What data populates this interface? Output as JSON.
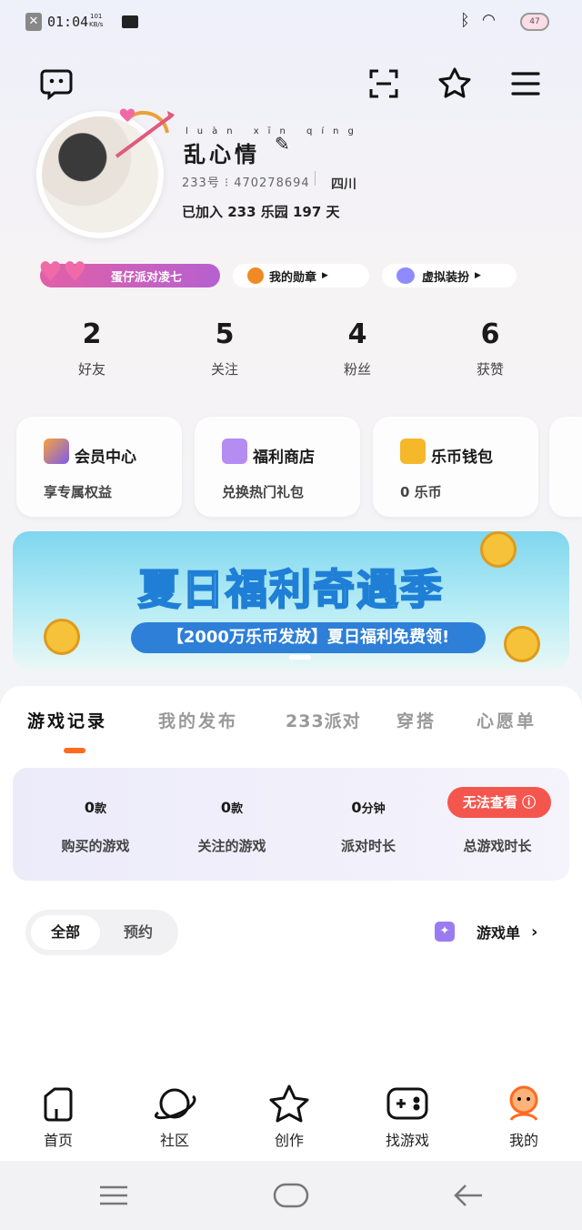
{
  "status": {
    "time": "01:04",
    "speed_top": "101",
    "speed_bottom": "KB/s",
    "battery": "47"
  },
  "profile": {
    "name": "乱心情",
    "name_pinyin": "luàn xīn qíng",
    "uid": "233号 ⁝ 470278694",
    "location": "四川",
    "joined": "已加入 233 乐园 197 天"
  },
  "chips": {
    "party": "蛋仔派对凌七",
    "medal": "我的勋章",
    "dress": "虚拟装扮"
  },
  "stats": [
    {
      "value": "2",
      "label": "好友"
    },
    {
      "value": "5",
      "label": "关注"
    },
    {
      "value": "4",
      "label": "粉丝"
    },
    {
      "value": "6",
      "label": "获赞"
    }
  ],
  "cards": [
    {
      "title": "会员中心",
      "sub": "享专属权益",
      "color": "#7b5cf0"
    },
    {
      "title": "福利商店",
      "sub": "兑换热门礼包",
      "color": "#b48cf2"
    },
    {
      "title": "乐币钱包",
      "sub": "0 乐币",
      "color": "#f5b82a"
    }
  ],
  "banner": {
    "title": "夏日福利奇遇季",
    "subtitle": "【2000万乐币发放】夏日福利免费领!"
  },
  "tabs": [
    "游戏记录",
    "我的发布",
    "233派对",
    "穿搭",
    "心愿单"
  ],
  "game_stats": [
    {
      "value": "0",
      "unit": "款",
      "label": "购买的游戏"
    },
    {
      "value": "0",
      "unit": "款",
      "label": "关注的游戏"
    },
    {
      "value": "0",
      "unit": "分钟",
      "label": "派对时长"
    },
    {
      "value": "",
      "unit": "",
      "label": "总游戏时长"
    }
  ],
  "cannot_view": "无法查看",
  "segment": {
    "all": "全部",
    "reserve": "预约"
  },
  "game_list": "游戏单",
  "bottom_tabs": [
    "首页",
    "社区",
    "创作",
    "找游戏",
    "我的"
  ],
  "colors": {
    "accent": "#ff6a21",
    "red": "#f4564e"
  }
}
